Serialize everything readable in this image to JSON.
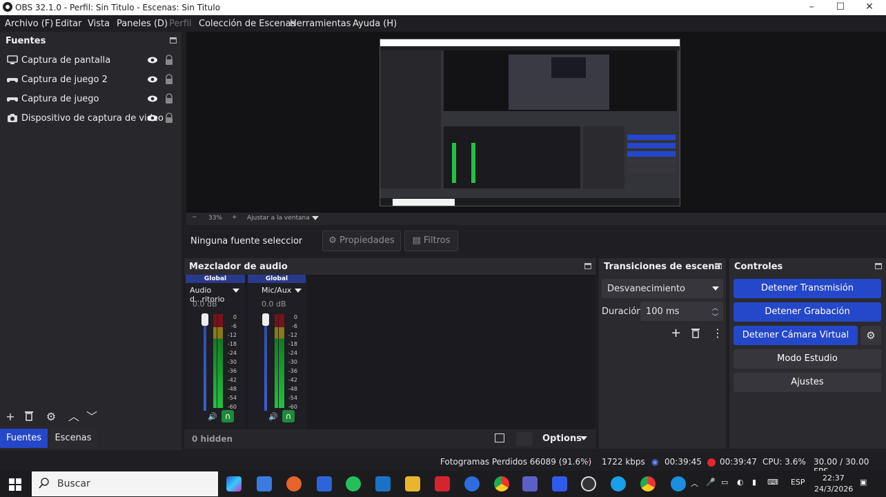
{
  "window": {
    "title": "OBS 32.1.0 - Perfil: Sin Titulo - Escenas: Sin Titulo"
  },
  "menu": {
    "archivo": "Archivo (F)",
    "editar": "Editar",
    "vista": "Vista",
    "paneles": "Paneles (D)",
    "perfil": "Perfil",
    "coleccion": "Colección de Escenas",
    "herramientas": "Herramientas",
    "ayuda": "Ayuda (H)"
  },
  "sources": {
    "title": "Fuentes",
    "items": [
      {
        "label": "Captura de pantalla",
        "icon": "monitor-icon"
      },
      {
        "label": "Captura de juego 2",
        "icon": "gamepad-icon"
      },
      {
        "label": "Captura de juego",
        "icon": "gamepad-icon"
      },
      {
        "label": "Dispositivo de captura de video",
        "icon": "camera-icon"
      }
    ]
  },
  "dock_tabs": {
    "fuentes": "Fuentes",
    "escenas": "Escenas"
  },
  "zoom": {
    "minus": "−",
    "value": "33%",
    "plus": "+",
    "fit": "Ajustar a la ventana"
  },
  "context": {
    "no_source": "Ninguna fuente seleccionad",
    "properties": "Propiedades",
    "filters": "Filtros"
  },
  "mixer": {
    "title": "Mezclador de audio",
    "channels": [
      {
        "global": "Global",
        "name": "Audio d...ritorio",
        "db": "0.0 dB"
      },
      {
        "global": "Global",
        "name": "Mic/Aux",
        "db": "0.0 dB"
      }
    ],
    "scale": [
      "0",
      "-6",
      "-12",
      "-18",
      "-24",
      "-30",
      "-36",
      "-42",
      "-48",
      "-54",
      "-60"
    ],
    "hidden": "0 hidden",
    "options": "Options"
  },
  "transitions": {
    "title": "Transiciones de escena",
    "selected": "Desvanecimiento",
    "duration_label": "Duración",
    "duration_value": "100 ms"
  },
  "controls": {
    "title": "Controles",
    "stop_stream": "Detener Transmisión",
    "stop_record": "Detener Grabación",
    "stop_vcam": "Detener Cámara Virtual",
    "studio": "Modo Estudio",
    "settings": "Ajustes"
  },
  "status": {
    "frames": "Fotogramas Perdidos 66089 (91.6%)",
    "kbps": "1722 kbps",
    "stream_time": "00:39:45",
    "record_time": "00:39:47",
    "cpu": "CPU: 3.6%",
    "fps": "30.00 / 30.00 FPS"
  },
  "taskbar": {
    "search_placeholder": "Buscar",
    "lang": "ESP",
    "time": "22:37",
    "date": "24/3/2026"
  },
  "colors": {
    "accent": "#2547c9",
    "rec": "#e0282e"
  }
}
